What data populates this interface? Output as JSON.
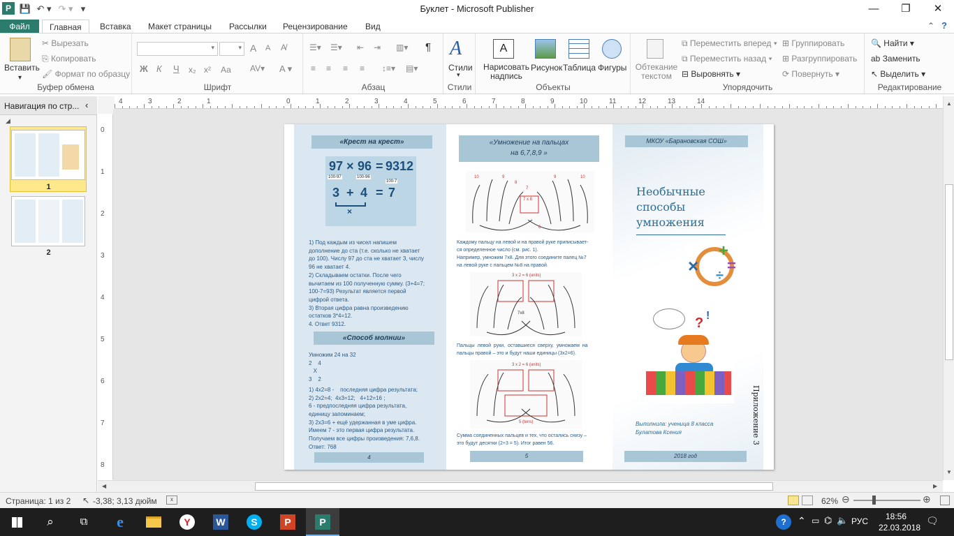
{
  "titlebar": {
    "title": "Буклет  -  Microsoft Publisher",
    "minimize": "—",
    "restore": "❐",
    "close": "✕"
  },
  "tabs": [
    "Файл",
    "Главная",
    "Вставка",
    "Макет страницы",
    "Рассылки",
    "Рецензирование",
    "Вид"
  ],
  "ribbon": {
    "clipboard": {
      "label": "Буфер обмена",
      "paste": "Вставить",
      "cut": "Вырезать",
      "copy": "Копировать",
      "format_painter": "Формат по образцу"
    },
    "font": {
      "label": "Шрифт",
      "bold": "Ж",
      "italic": "К",
      "underline": "Ч",
      "sub": "x₂",
      "sup": "x²",
      "case": "Аа",
      "grow": "A",
      "shrink": "A"
    },
    "paragraph": {
      "label": "Абзац",
      "pilcrow": "¶"
    },
    "styles": {
      "label": "Стили",
      "button": "Стили"
    },
    "objects": {
      "label": "Объекты",
      "textbox": "Нарисовать надпись",
      "picture": "Рисунок",
      "table": "Таблица",
      "shapes": "Фигуры"
    },
    "arrange": {
      "label": "Упорядочить",
      "wrap": "Обтекание текстом",
      "bring_forward": "Переместить вперед",
      "send_backward": "Переместить назад",
      "align": "Выровнять",
      "group": "Группировать",
      "ungroup": "Разгруппировать",
      "rotate": "Повернуть"
    },
    "editing": {
      "label": "Редактирование",
      "find": "Найти",
      "replace": "Заменить",
      "select": "Выделить"
    }
  },
  "nav": {
    "title": "Навигация по стр...",
    "pages": [
      "1",
      "2"
    ]
  },
  "hruler_ticks": [
    "4",
    "3",
    "2",
    "1",
    "0",
    "1",
    "2",
    "3",
    "4",
    "5",
    "6",
    "7",
    "8",
    "9",
    "10",
    "11",
    "12",
    "13",
    "14"
  ],
  "vruler_ticks": [
    "0",
    "1",
    "2",
    "3",
    "4",
    "5",
    "6",
    "7",
    "8"
  ],
  "brochure": {
    "left": {
      "heading1": "«Крест на крест»",
      "equation": {
        "a": "97",
        "times": "×",
        "b": "96",
        "eq": "=",
        "result": "9312",
        "note_a": "100-97",
        "note_b": "100-96",
        "note_c": "100-7",
        "sum_a": "3",
        "plus": "+",
        "sum_b": "4",
        "sum_eq": "=",
        "sum_res": "7",
        "mult": "×"
      },
      "text1": [
        "1) Под каждым из чисел напишем",
        "дополнение до ста (т.е. сколько не хватает",
        "до 100). Числу 97 до ста не хватает 3, числу",
        "96 не хватает 4.",
        "2) Складываем остатки. После чего",
        "вычитаем из 100 полученную сумму. (3+4=7;",
        "100-7=93) Результат является первой",
        "цифрой ответа.",
        "3) Вторая цифра равна произведению",
        "остатков 3*4=12.",
        "4. Ответ 9312."
      ],
      "heading2": "«Способ молнии»",
      "text2": [
        "Умножим 24 на 32",
        "2    4",
        "   X",
        "3    2",
        "1) 4х2=8 -    последняя цифра результата;",
        "2) 2х2=4;  4х3=12;   4+12=16 ;",
        "6 - предпоследняя цифра результата,",
        "единицу запоминаем;",
        "3) 2х3=6 + ещё удержанная в уме цифра.",
        "Имеем 7 - это первая цифра результата.",
        "Получаем все цифры произведения: 7,6,8.",
        "Ответ: 768"
      ],
      "page_num": "4"
    },
    "middle": {
      "heading": [
        "«Умножение на пальцах",
        "на 6,7,8,9 »"
      ],
      "fig1_labels": [
        "10",
        "9",
        "8",
        "7",
        "6",
        "9",
        "10",
        "7 х 8"
      ],
      "text1": [
        "Каждому пальцу на левой и на правой руке приписывает-",
        "ся определенное число  (см. рис. 1).",
        "Например, умножим 7х8. Для этого соедините палец №7",
        "на левой руке с пальцем №8  на правой."
      ],
      "fig2_label": "3 x 2 = 6 (units)",
      "fig2_side": "7x8",
      "text2": [
        "Пальцы  левой  руки,  оставшиеся  сверху,  умножаем  на",
        "пальцы правой – это и будут наши единицы  (3х2=6)."
      ],
      "fig3_label": "3 x 2 = 6 (units)",
      "fig3_bottom": "5 (tens)",
      "text3": [
        "Сумма соединенных пальцев и тех, что остались  снизу –",
        "это будут десятки (2+3 = 5). Итог равен 56."
      ],
      "page_num": "5"
    },
    "right": {
      "heading": "МКОУ «Барановская СОШ»",
      "title": [
        "Необычные",
        "способы",
        "умножения"
      ],
      "author": [
        "Выполнила: ученица 8 класса",
        "Булатова Ксения"
      ],
      "vertical": "Приложение 3",
      "year": "2018 год"
    }
  },
  "status": {
    "page": "Страница: 1 из 2",
    "coords": "-3,38; 3,13 дюйм",
    "zoom": "62%"
  },
  "taskbar": {
    "lang": "РУС",
    "time": "18:56",
    "date": "22.03.2018"
  },
  "colors": {
    "file_tab": "#2b7c6c",
    "panel_blue": "#dce8f1",
    "heading_bar": "#a9c6d7",
    "text_blue": "#2a5a85"
  }
}
